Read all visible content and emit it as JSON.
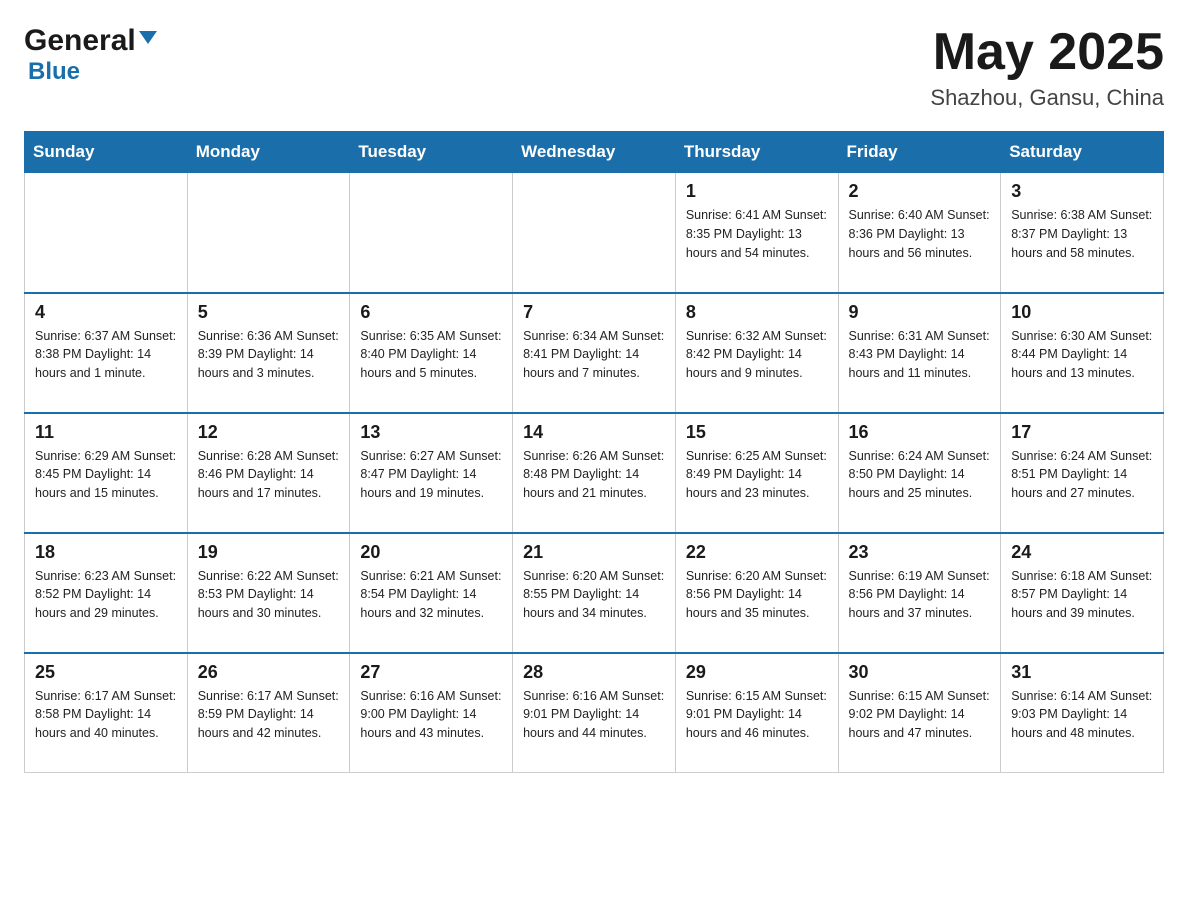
{
  "header": {
    "month_title": "May 2025",
    "location": "Shazhou, Gansu, China",
    "logo_general": "General",
    "logo_blue": "Blue"
  },
  "weekdays": [
    "Sunday",
    "Monday",
    "Tuesday",
    "Wednesday",
    "Thursday",
    "Friday",
    "Saturday"
  ],
  "rows": [
    {
      "cells": [
        {
          "day": "",
          "info": ""
        },
        {
          "day": "",
          "info": ""
        },
        {
          "day": "",
          "info": ""
        },
        {
          "day": "",
          "info": ""
        },
        {
          "day": "1",
          "info": "Sunrise: 6:41 AM\nSunset: 8:35 PM\nDaylight: 13 hours\nand 54 minutes."
        },
        {
          "day": "2",
          "info": "Sunrise: 6:40 AM\nSunset: 8:36 PM\nDaylight: 13 hours\nand 56 minutes."
        },
        {
          "day": "3",
          "info": "Sunrise: 6:38 AM\nSunset: 8:37 PM\nDaylight: 13 hours\nand 58 minutes."
        }
      ]
    },
    {
      "cells": [
        {
          "day": "4",
          "info": "Sunrise: 6:37 AM\nSunset: 8:38 PM\nDaylight: 14 hours\nand 1 minute."
        },
        {
          "day": "5",
          "info": "Sunrise: 6:36 AM\nSunset: 8:39 PM\nDaylight: 14 hours\nand 3 minutes."
        },
        {
          "day": "6",
          "info": "Sunrise: 6:35 AM\nSunset: 8:40 PM\nDaylight: 14 hours\nand 5 minutes."
        },
        {
          "day": "7",
          "info": "Sunrise: 6:34 AM\nSunset: 8:41 PM\nDaylight: 14 hours\nand 7 minutes."
        },
        {
          "day": "8",
          "info": "Sunrise: 6:32 AM\nSunset: 8:42 PM\nDaylight: 14 hours\nand 9 minutes."
        },
        {
          "day": "9",
          "info": "Sunrise: 6:31 AM\nSunset: 8:43 PM\nDaylight: 14 hours\nand 11 minutes."
        },
        {
          "day": "10",
          "info": "Sunrise: 6:30 AM\nSunset: 8:44 PM\nDaylight: 14 hours\nand 13 minutes."
        }
      ]
    },
    {
      "cells": [
        {
          "day": "11",
          "info": "Sunrise: 6:29 AM\nSunset: 8:45 PM\nDaylight: 14 hours\nand 15 minutes."
        },
        {
          "day": "12",
          "info": "Sunrise: 6:28 AM\nSunset: 8:46 PM\nDaylight: 14 hours\nand 17 minutes."
        },
        {
          "day": "13",
          "info": "Sunrise: 6:27 AM\nSunset: 8:47 PM\nDaylight: 14 hours\nand 19 minutes."
        },
        {
          "day": "14",
          "info": "Sunrise: 6:26 AM\nSunset: 8:48 PM\nDaylight: 14 hours\nand 21 minutes."
        },
        {
          "day": "15",
          "info": "Sunrise: 6:25 AM\nSunset: 8:49 PM\nDaylight: 14 hours\nand 23 minutes."
        },
        {
          "day": "16",
          "info": "Sunrise: 6:24 AM\nSunset: 8:50 PM\nDaylight: 14 hours\nand 25 minutes."
        },
        {
          "day": "17",
          "info": "Sunrise: 6:24 AM\nSunset: 8:51 PM\nDaylight: 14 hours\nand 27 minutes."
        }
      ]
    },
    {
      "cells": [
        {
          "day": "18",
          "info": "Sunrise: 6:23 AM\nSunset: 8:52 PM\nDaylight: 14 hours\nand 29 minutes."
        },
        {
          "day": "19",
          "info": "Sunrise: 6:22 AM\nSunset: 8:53 PM\nDaylight: 14 hours\nand 30 minutes."
        },
        {
          "day": "20",
          "info": "Sunrise: 6:21 AM\nSunset: 8:54 PM\nDaylight: 14 hours\nand 32 minutes."
        },
        {
          "day": "21",
          "info": "Sunrise: 6:20 AM\nSunset: 8:55 PM\nDaylight: 14 hours\nand 34 minutes."
        },
        {
          "day": "22",
          "info": "Sunrise: 6:20 AM\nSunset: 8:56 PM\nDaylight: 14 hours\nand 35 minutes."
        },
        {
          "day": "23",
          "info": "Sunrise: 6:19 AM\nSunset: 8:56 PM\nDaylight: 14 hours\nand 37 minutes."
        },
        {
          "day": "24",
          "info": "Sunrise: 6:18 AM\nSunset: 8:57 PM\nDaylight: 14 hours\nand 39 minutes."
        }
      ]
    },
    {
      "cells": [
        {
          "day": "25",
          "info": "Sunrise: 6:17 AM\nSunset: 8:58 PM\nDaylight: 14 hours\nand 40 minutes."
        },
        {
          "day": "26",
          "info": "Sunrise: 6:17 AM\nSunset: 8:59 PM\nDaylight: 14 hours\nand 42 minutes."
        },
        {
          "day": "27",
          "info": "Sunrise: 6:16 AM\nSunset: 9:00 PM\nDaylight: 14 hours\nand 43 minutes."
        },
        {
          "day": "28",
          "info": "Sunrise: 6:16 AM\nSunset: 9:01 PM\nDaylight: 14 hours\nand 44 minutes."
        },
        {
          "day": "29",
          "info": "Sunrise: 6:15 AM\nSunset: 9:01 PM\nDaylight: 14 hours\nand 46 minutes."
        },
        {
          "day": "30",
          "info": "Sunrise: 6:15 AM\nSunset: 9:02 PM\nDaylight: 14 hours\nand 47 minutes."
        },
        {
          "day": "31",
          "info": "Sunrise: 6:14 AM\nSunset: 9:03 PM\nDaylight: 14 hours\nand 48 minutes."
        }
      ]
    }
  ]
}
